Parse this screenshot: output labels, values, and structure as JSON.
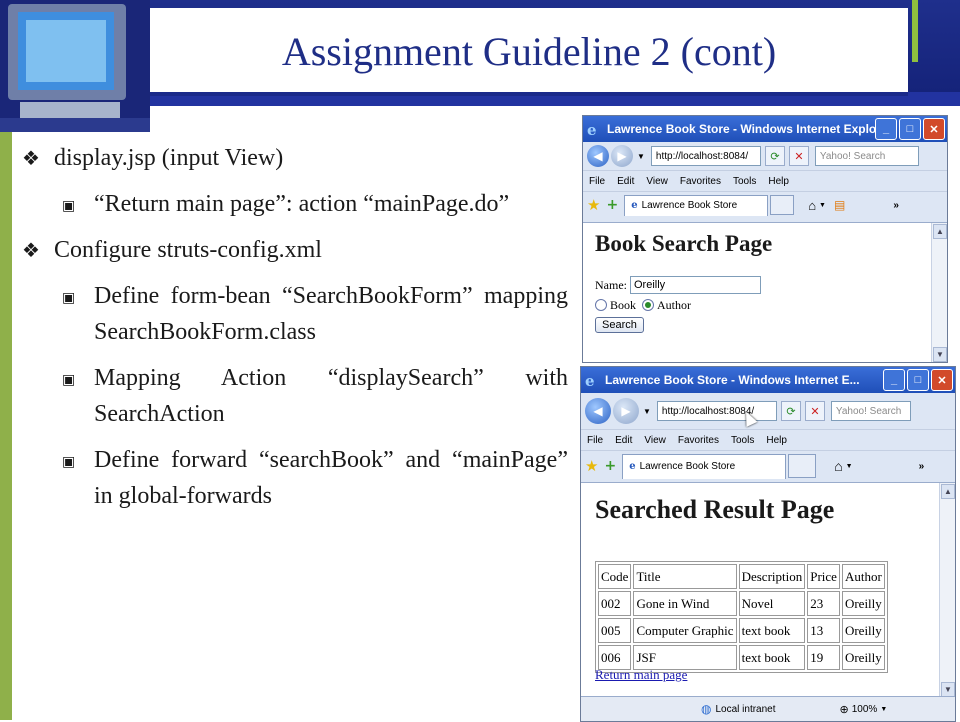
{
  "slide": {
    "title": "Assignment Guideline 2 (cont)",
    "colors": {
      "header": "#1f2f8c",
      "title": "#1f2e86",
      "accent": "#8fbf3f"
    }
  },
  "bullets": [
    {
      "text": "display.jsp (input View)",
      "icon": "diamond-bullet-icon",
      "sub": [
        {
          "text": "“Return main page”: action “mainPage.do”"
        }
      ]
    },
    {
      "text": "Configure struts-config.xml",
      "icon": "diamond-bullet-icon",
      "sub": [
        {
          "text": "Define form-bean “SearchBookForm” mapping SearchBookForm.class"
        },
        {
          "text": "Mapping Action “displaySearch” with SearchAction"
        },
        {
          "text": "Define forward “searchBook” and “mainPage” in global-forwards"
        }
      ]
    }
  ],
  "window1": {
    "title": "Lawrence Book Store - Windows Internet Explorer",
    "url": "http://localhost:8084/",
    "search_placeholder": "Yahoo! Search",
    "menu": [
      "File",
      "Edit",
      "View",
      "Favorites",
      "Tools",
      "Help"
    ],
    "tab": "Lawrence Book Store",
    "chevron": "»",
    "page": {
      "heading": "Book Search Page",
      "name_label": "Name:",
      "name_value": "Oreilly",
      "radio_book": "Book",
      "radio_author": "Author",
      "selected": "Author",
      "search_button": "Search"
    }
  },
  "window2": {
    "title": "Lawrence Book Store - Windows Internet E...",
    "url": "http://localhost:8084/",
    "search_placeholder": "Yahoo! Search",
    "menu": [
      "File",
      "Edit",
      "View",
      "Favorites",
      "Tools",
      "Help"
    ],
    "tab": "Lawrence Book Store",
    "chevron": "»",
    "page": {
      "heading": "Searched Result Page",
      "columns": [
        "Code",
        "Title",
        "Description",
        "Price",
        "Author"
      ],
      "rows": [
        [
          "002",
          "Gone in Wind",
          "Novel",
          "23",
          "Oreilly"
        ],
        [
          "005",
          "Computer Graphic",
          "text book",
          "13",
          "Oreilly"
        ],
        [
          "006",
          "JSF",
          "text book",
          "19",
          "Oreilly"
        ]
      ],
      "link": "Return main page"
    },
    "status": {
      "zone": "Local intranet",
      "zoom": "100%"
    }
  }
}
